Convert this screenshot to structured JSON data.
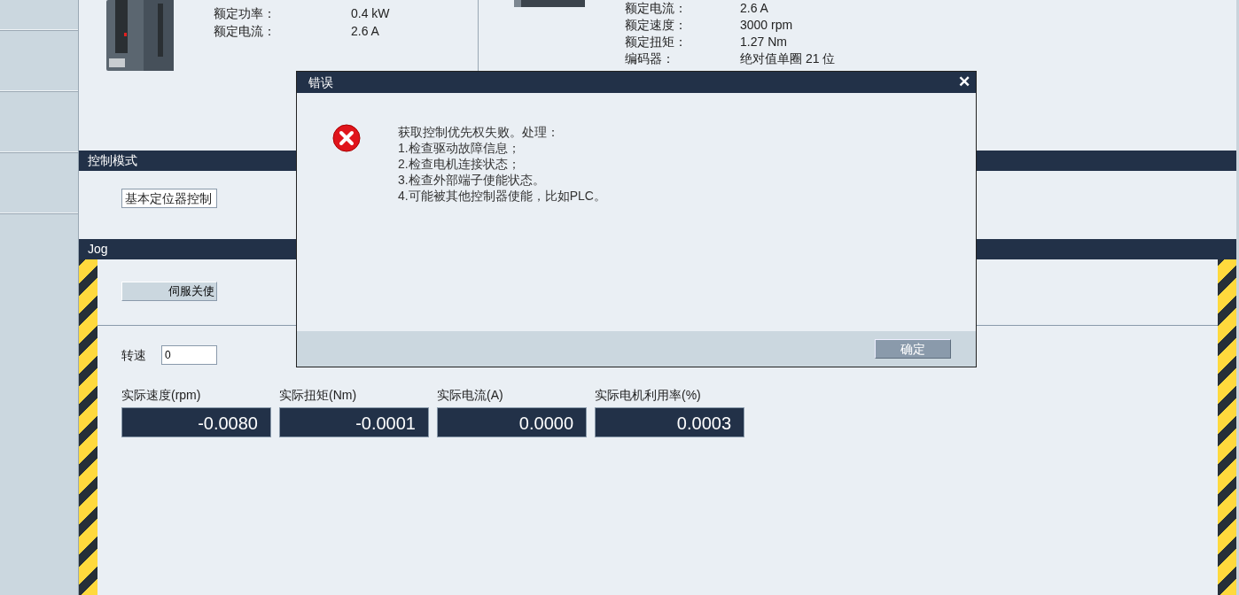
{
  "drive": {
    "specs": [
      {
        "label": "额定功率：",
        "value": "0.4 kW"
      },
      {
        "label": "额定电流：",
        "value": "2.6 A"
      }
    ]
  },
  "motor": {
    "specs": [
      {
        "label": "额定电流：",
        "value": "2.6 A"
      },
      {
        "label": "额定速度：",
        "value": "3000 rpm"
      },
      {
        "label": "额定扭矩：",
        "value": "1.27 Nm"
      },
      {
        "label": "编码器：",
        "value": "绝对值单圈 21 位"
      }
    ]
  },
  "control_mode": {
    "title": "控制模式",
    "mode": {
      "value": "基本定位器控制"
    }
  },
  "jog": {
    "title": "Jog",
    "servo_button": "伺服关使",
    "speed": {
      "label": "转速",
      "value": "0"
    },
    "readouts": [
      {
        "label": "实际速度(rpm)",
        "value": "-0.0080"
      },
      {
        "label": "实际扭矩(Nm)",
        "value": "-0.0001"
      },
      {
        "label": "实际电流(A)",
        "value": "0.0000"
      },
      {
        "label": "实际电机利用率(%)",
        "value": "0.0003"
      }
    ]
  },
  "dialog": {
    "title": "错误",
    "close": "✕",
    "message_lines": [
      "获取控制优先权失败。处理：",
      "1.检查驱动故障信息；",
      "2.检查电机连接状态；",
      "3.检查外部端子使能状态。",
      "4.可能被其他控制器使能，比如PLC。"
    ],
    "ok_button": "确定"
  }
}
